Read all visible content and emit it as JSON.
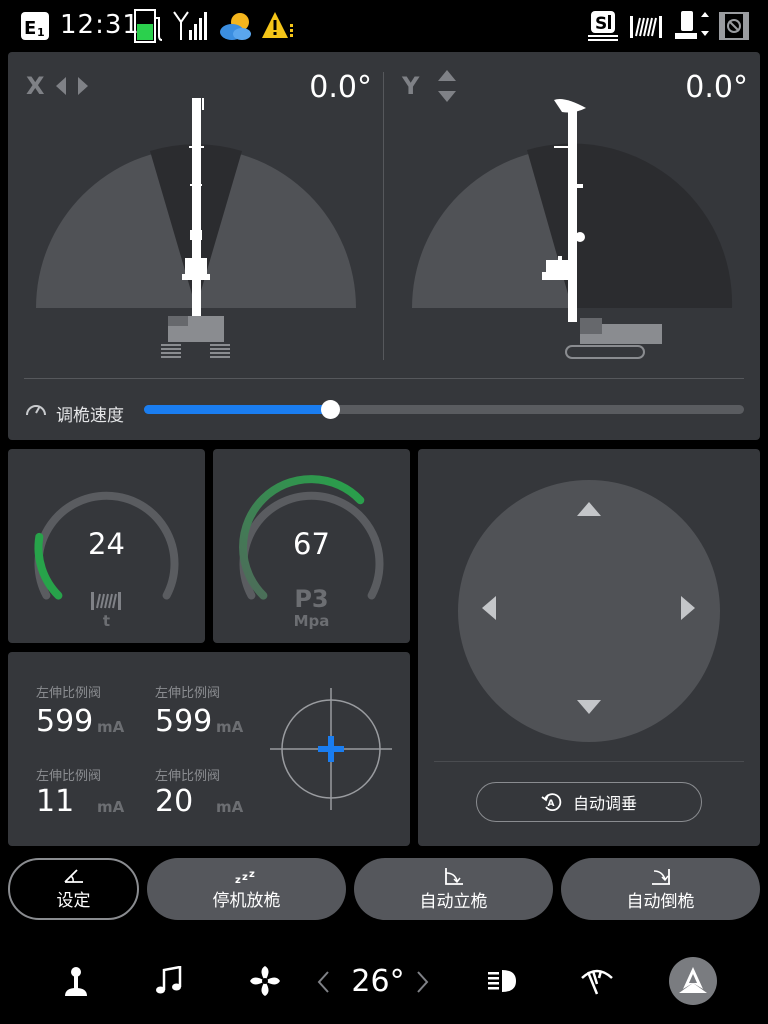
{
  "status_bar": {
    "time": "12:31",
    "icons": [
      "e1-icon",
      "fuel-gauge-icon",
      "signal-icon",
      "weather-partly-cloudy-icon",
      "warning-icon",
      "s1-mode-icon",
      "winch-icon",
      "mast-adjust-icon",
      "camera-off-icon"
    ]
  },
  "tilt": {
    "x": {
      "axis_label": "X",
      "value": "0.0°"
    },
    "y": {
      "axis_label": "Y",
      "value": "0.0°"
    },
    "speed_label": "调桅速度",
    "speed_level": 0.31
  },
  "gauges": {
    "load": {
      "value": "24",
      "unit": "t",
      "level": 0.2
    },
    "pressure": {
      "value": "67",
      "title": "P3",
      "unit": "Mpa",
      "level": 0.67
    }
  },
  "valves": [
    {
      "label": "左伸比例阀",
      "value": "599",
      "unit": "mA"
    },
    {
      "label": "左伸比例阀",
      "value": "599",
      "unit": "mA"
    },
    {
      "label": "左伸比例阀",
      "value": "11",
      "unit": "mA"
    },
    {
      "label": "左伸比例阀",
      "value": "20",
      "unit": "mA"
    }
  ],
  "joystick": {
    "auto_label": "自动调垂"
  },
  "actions": {
    "settings": "设定",
    "park": "停机放桅",
    "auto_raise": "自动立桅",
    "auto_lower": "自动倒桅"
  },
  "bottom_nav": {
    "temperature": "26°",
    "icons": [
      "joystick-icon",
      "music-icon",
      "fan-icon",
      "headlight-icon",
      "wiper-icon",
      "logo-icon"
    ]
  },
  "colors": {
    "accent": "#1a7df0",
    "gauge_green": "#27a34a",
    "panel": "#35373b"
  }
}
